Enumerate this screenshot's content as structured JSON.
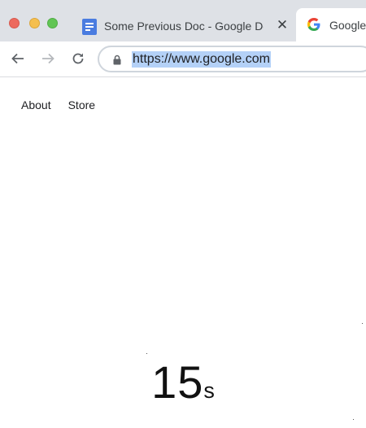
{
  "window": {
    "controls": [
      "close",
      "minimize",
      "zoom"
    ]
  },
  "tabs": [
    {
      "title": "Some Previous Doc - Google Docs",
      "icon": "google-docs-icon",
      "active": false
    },
    {
      "title": "Google",
      "icon": "google-g-icon",
      "active": true
    }
  ],
  "toolbar": {
    "url": "https://www.google.com",
    "icons": [
      "back-arrow-icon",
      "forward-arrow-icon",
      "reload-icon",
      "lock-icon"
    ]
  },
  "page": {
    "links": [
      "About",
      "Store"
    ],
    "timer": {
      "value": "15",
      "unit": "s"
    }
  }
}
